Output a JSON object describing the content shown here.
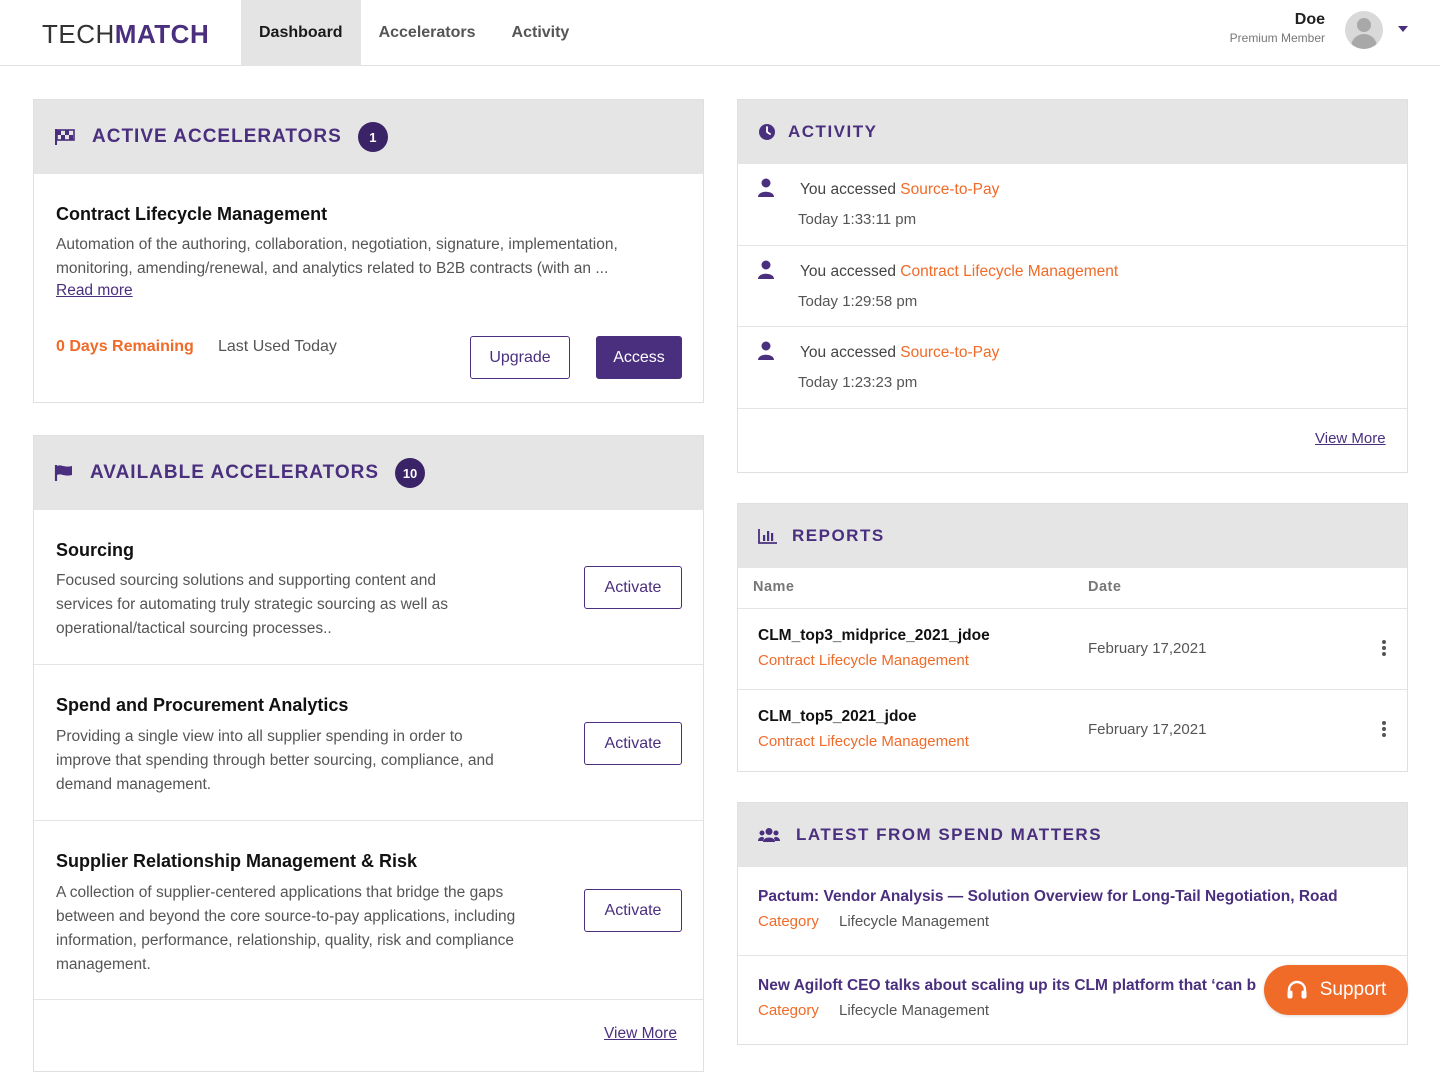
{
  "header": {
    "logo_light": "TECH",
    "logo_bold": "MATCH",
    "tabs": [
      {
        "label": "Dashboard",
        "active": true
      },
      {
        "label": "Accelerators",
        "active": false
      },
      {
        "label": "Activity",
        "active": false
      }
    ],
    "user": {
      "name": "Doe",
      "role": "Premium Member"
    }
  },
  "active_accelerators": {
    "icon": "checkered-flag-icon",
    "title": "ACTIVE ACCELERATORS",
    "count": "1",
    "item": {
      "title": "Contract Lifecycle Management",
      "description": "Automation of the authoring, collaboration, negotiation, signature, implementation, monitoring, amending/renewal, and analytics related to B2B contracts (with an ...",
      "read_more": "Read more",
      "days_remaining": "0 Days Remaining",
      "last_used": "Last Used Today",
      "upgrade_label": "Upgrade",
      "access_label": "Access"
    }
  },
  "available_accelerators": {
    "icon": "flag-icon",
    "title": "AVAILABLE ACCELERATORS",
    "count": "10",
    "items": [
      {
        "title": "Sourcing",
        "description": "Focused sourcing solutions and supporting content and services for automating truly strategic sourcing as well as operational/tactical sourcing processes..",
        "action": "Activate"
      },
      {
        "title": "Spend and Procurement Analytics",
        "description": "Providing a single view into all supplier spending in order to improve that spending through better sourcing, compliance, and demand management.",
        "action": "Activate"
      },
      {
        "title": "Supplier Relationship Management & Risk",
        "description": "A collection of supplier-centered applications that bridge the gaps between and beyond the core source-to-pay applications, including information, performance, relationship, quality, risk and compliance management.",
        "action": "Activate"
      }
    ],
    "view_more": "View More"
  },
  "activity": {
    "icon": "clock-icon",
    "title": "ACTIVITY",
    "items": [
      {
        "prefix": "You accessed",
        "target": "Source-to-Pay",
        "time": "Today 1:33:11 pm"
      },
      {
        "prefix": "You accessed",
        "target": "Contract Lifecycle Management",
        "time": "Today 1:29:58 pm"
      },
      {
        "prefix": "You accessed",
        "target": "Source-to-Pay",
        "time": "Today 1:23:23 pm"
      }
    ],
    "view_more": "View More"
  },
  "reports": {
    "icon": "bar-chart-icon",
    "title": "REPORTS",
    "col_name": "Name",
    "col_date": "Date",
    "rows": [
      {
        "name": "CLM_top3_midprice_2021_jdoe",
        "category": "Contract Lifecycle Management",
        "date": "February 17,2021"
      },
      {
        "name": "CLM_top5_2021_jdoe",
        "category": "Contract Lifecycle Management",
        "date": "February 17,2021"
      }
    ]
  },
  "news": {
    "icon": "users-icon",
    "title": "LATEST FROM SPEND MATTERS",
    "items": [
      {
        "title": "Pactum: Vendor Analysis — Solution Overview for Long-Tail Negotiation, Road",
        "category_label": "Category",
        "category": "Lifecycle Management"
      },
      {
        "title": "New Agiloft CEO talks about scaling up its CLM platform that ‘can b",
        "category_label": "Category",
        "category": "Lifecycle Management"
      }
    ]
  },
  "support": {
    "label": "Support",
    "icon": "headset-icon"
  },
  "colors": {
    "brand": "#4a2f7e",
    "accent": "#f06a28",
    "panel_header": "#e5e5e5"
  }
}
